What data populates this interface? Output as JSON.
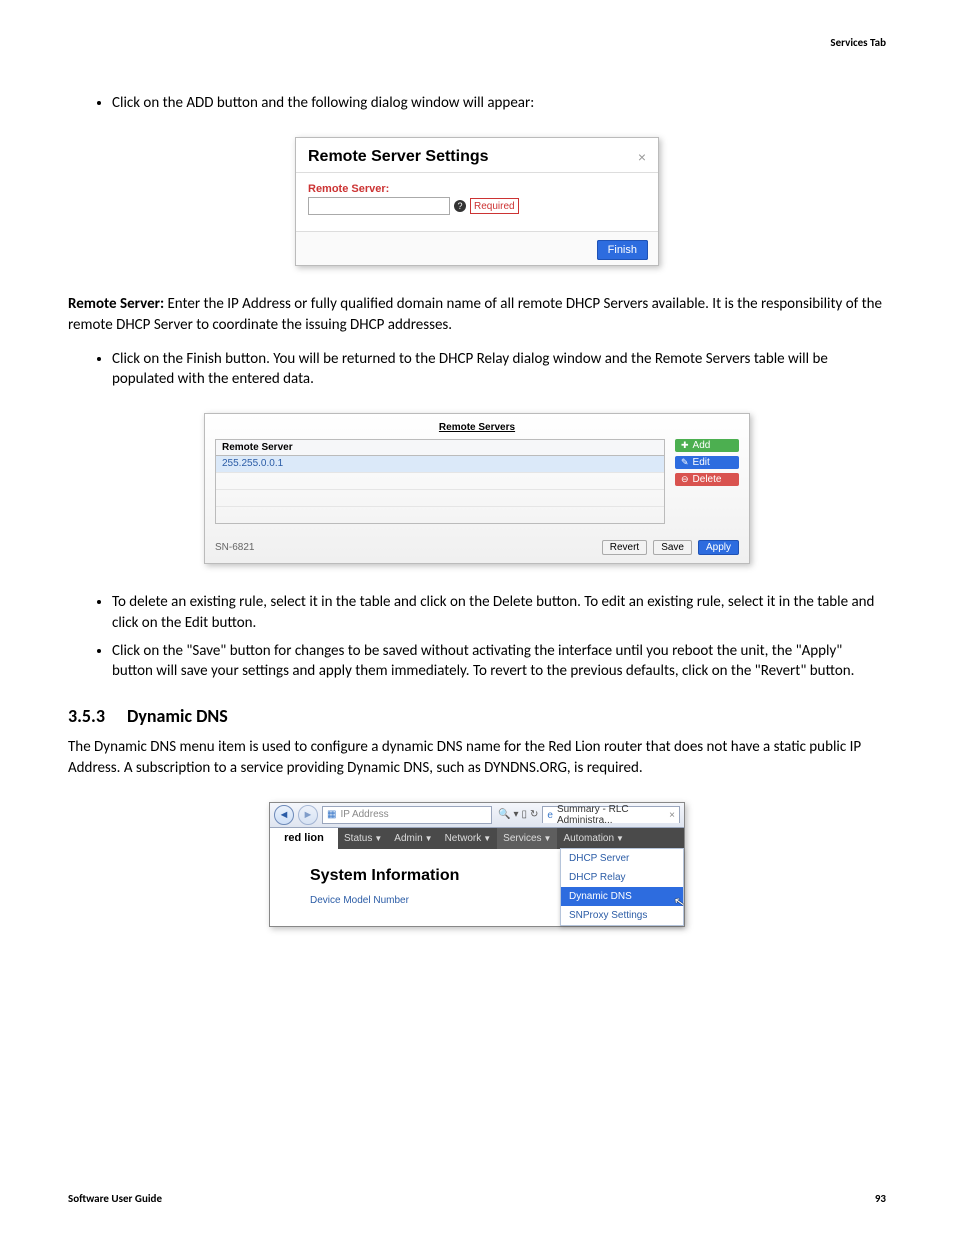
{
  "header": {
    "tab_label": "Services Tab"
  },
  "bullets": {
    "b1": "Click on the ADD button and the following dialog window will appear:",
    "b2": "Click on the Finish button. You will be returned to the DHCP Relay dialog window and the Remote Servers table will be populated with the entered data.",
    "b3": "To delete an existing rule, select it in the table and click on the Delete button. To edit an existing rule, select it in the table and click on the Edit button.",
    "b4": "Click on the \"Save\" button for changes to be saved without activating the interface until you reboot the unit, the \"Apply\" button will save your settings and apply them immediately. To revert to the previous defaults, click on the \"Revert\" button."
  },
  "dialog": {
    "title": "Remote Server Settings",
    "close": "×",
    "field_label": "Remote Server:",
    "required": "Required",
    "help": "?",
    "finish": "Finish"
  },
  "remote_desc": {
    "label": "Remote Server:",
    "text": " Enter the IP Address or fully qualified domain name of all remote DHCP Servers available. It is the responsibility of the remote DHCP Server to coordinate the issuing DHCP addresses."
  },
  "table": {
    "title": "Remote Servers",
    "col1": "Remote Server",
    "row1": "255.255.0.0.1",
    "add": "Add",
    "edit": "Edit",
    "delete": "Delete",
    "sn": "SN-6821",
    "revert": "Revert",
    "save": "Save",
    "apply": "Apply"
  },
  "section": {
    "num": "3.5.3",
    "title": "Dynamic DNS"
  },
  "section_para": "The Dynamic DNS menu item is used to configure a dynamic DNS name for the Red Lion router that does not have a static public IP Address. A subscription to a service providing Dynamic DNS, such as DYNDNS.ORG, is required.",
  "browser": {
    "addr": "IP Address",
    "search_glyph": "🔍",
    "tab_title": "Summary - RLC Administra...",
    "tab_close": "×",
    "logo": "red lion",
    "menu": {
      "status": "Status",
      "admin": "Admin",
      "network": "Network",
      "services": "Services",
      "automation": "Automation"
    },
    "sys_info": "System Information",
    "model": "Device Model Number",
    "dd": {
      "i1": "DHCP Server",
      "i2": "DHCP Relay",
      "i3": "Dynamic DNS",
      "i4": "SNProxy Settings"
    }
  },
  "footer": {
    "left": "Software User Guide",
    "right": "93"
  }
}
